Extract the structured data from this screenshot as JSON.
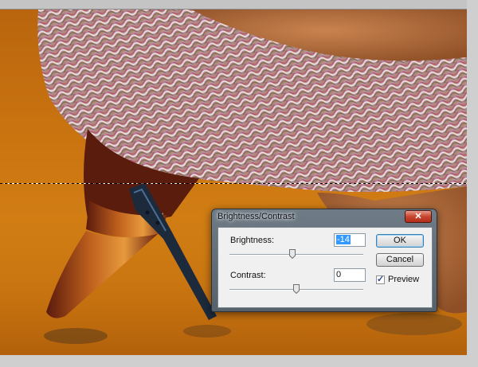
{
  "dialog": {
    "title": "Brightness/Contrast",
    "close_icon": "close-icon",
    "brightness": {
      "label": "Brightness:",
      "value": "-14",
      "slider_fraction": 0.47
    },
    "contrast": {
      "label": "Contrast:",
      "value": "0",
      "slider_fraction": 0.5
    },
    "ok_label": "OK",
    "cancel_label": "Cancel",
    "preview_label": "Preview",
    "preview_checked": true
  },
  "colors": {
    "canvas_background": "#c97310",
    "selection_accent": "#3399ff",
    "close_button": "#c8462f"
  }
}
